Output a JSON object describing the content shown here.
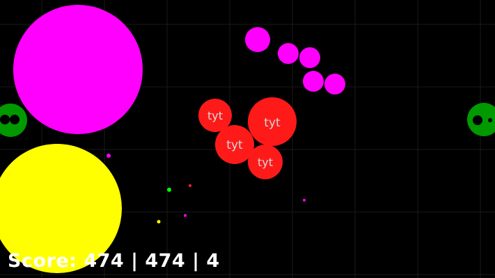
{
  "game": {
    "score_text": "Score: 474 | 474 | 4",
    "player_name": "tyt",
    "colors": {
      "background": "#000000",
      "grid": "#1a1a1a",
      "player": "#ff1a1a",
      "player_text": "#d9d9d9",
      "magenta": "#ff00ff",
      "yellow": "#ffff00",
      "green": "#009900"
    }
  }
}
